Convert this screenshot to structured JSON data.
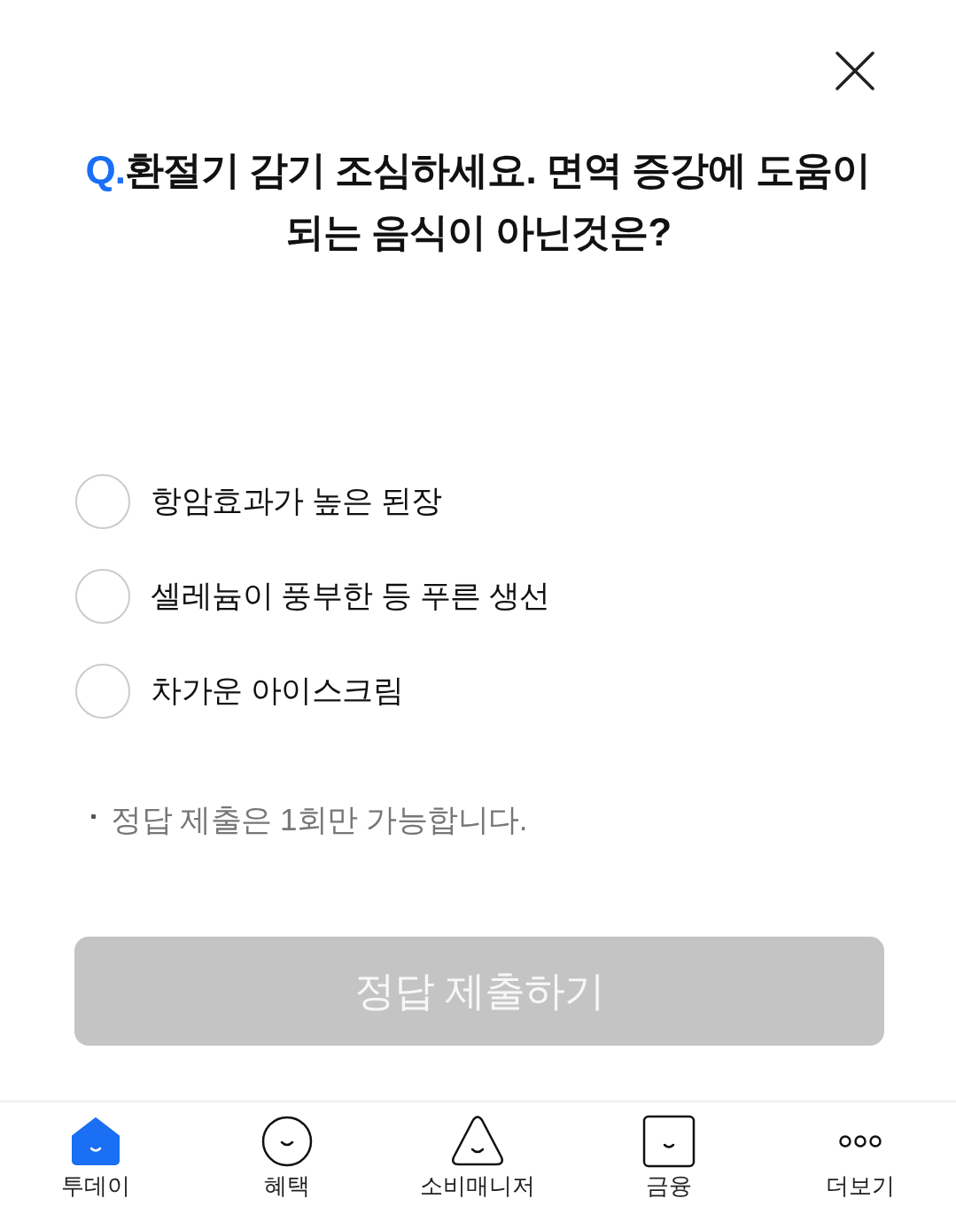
{
  "question": {
    "prefix": "Q.",
    "text": "환절기 감기 조심하세요. 면역 증강에 도움이 되는 음식이 아닌것은?"
  },
  "options": [
    {
      "label": "항암효과가 높은 된장",
      "selected": false
    },
    {
      "label": "셀레늄이 풍부한 등 푸른 생선",
      "selected": false
    },
    {
      "label": "차가운 아이스크림",
      "selected": false
    }
  ],
  "notes": [
    "정답 제출은 1회만 가능합니다."
  ],
  "submit_button": {
    "label": "정답 제출하기",
    "disabled": true
  },
  "tab_bar": {
    "items": [
      {
        "label": "투데이",
        "kind": "home",
        "selected": true
      },
      {
        "label": "혜택",
        "kind": "circle",
        "selected": false
      },
      {
        "label": "소비매니저",
        "kind": "triangle",
        "selected": false
      },
      {
        "label": "금융",
        "kind": "square",
        "selected": false
      },
      {
        "label": "더보기",
        "kind": "more",
        "selected": false
      }
    ]
  }
}
